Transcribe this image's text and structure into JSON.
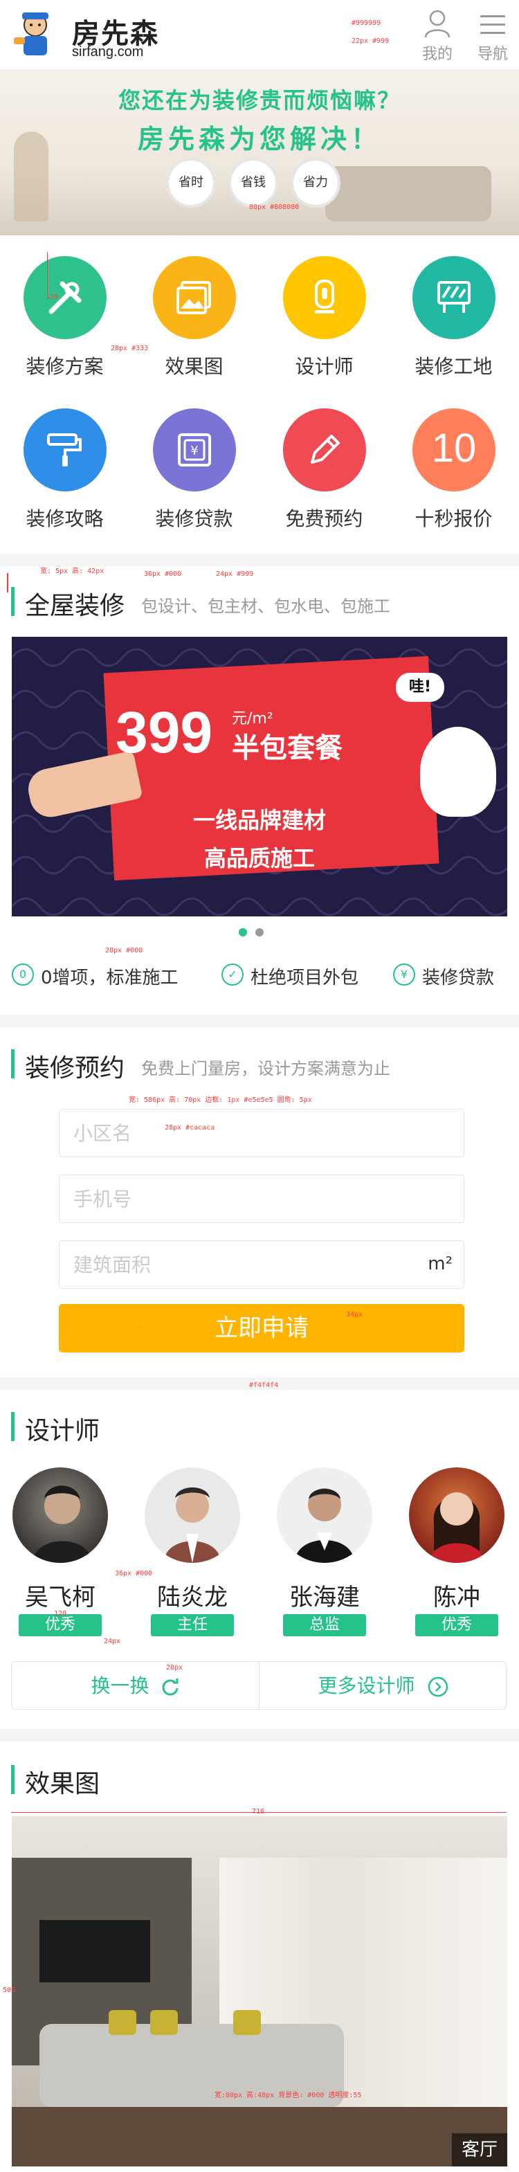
{
  "header": {
    "logo_cn": "房先森",
    "logo_en": "sirfang.com",
    "mine_label": "我的",
    "nav_label": "导航"
  },
  "hero": {
    "line1": "您还在为装修贵而烦恼嘛？",
    "line2": "房先森为您解决！",
    "pills": [
      "省时",
      "省钱",
      "省力"
    ]
  },
  "grid": [
    {
      "label": "装修方案",
      "color": "#2fc28c",
      "icon": "tools-icon"
    },
    {
      "label": "效果图",
      "color": "#fbb415",
      "icon": "gallery-icon"
    },
    {
      "label": "设计师",
      "color": "#ffc600",
      "icon": "pen-nib-icon"
    },
    {
      "label": "装修工地",
      "color": "#21b8a4",
      "icon": "construction-sign-icon"
    },
    {
      "label": "装修攻略",
      "color": "#2f8ee8",
      "icon": "paint-roller-icon"
    },
    {
      "label": "装修贷款",
      "color": "#7a74d6",
      "icon": "loan-document-icon"
    },
    {
      "label": "免费预约",
      "color": "#f04a54",
      "icon": "pencil-icon"
    },
    {
      "label": "十秒报价",
      "color": "#ff7f5a",
      "icon": "ten-seconds-icon",
      "icon_text": "10"
    }
  ],
  "whole_house": {
    "title": "全屋装修",
    "subtitle": "包设计、包主材、包水电、包施工",
    "banner": {
      "price": "399",
      "unit": "元/m²",
      "tag": "半包套餐",
      "line1": "一线品牌建材",
      "line2": "高品质施工",
      "exclaim": "哇!"
    },
    "features": [
      {
        "icon_text": "0",
        "label": "0增项，标准施工"
      },
      {
        "icon_text": "✓",
        "label": "杜绝项目外包"
      },
      {
        "icon_text": "¥",
        "label": "装修贷款"
      }
    ]
  },
  "booking": {
    "title": "装修预约",
    "subtitle": "免费上门量房，设计方案满意为止",
    "community_placeholder": "小区名",
    "phone_placeholder": "手机号",
    "area_placeholder": "建筑面积",
    "area_unit": "m²",
    "submit_label": "立即申请"
  },
  "designers": {
    "title": "设计师",
    "items": [
      {
        "name": "吴飞柯",
        "badge": "优秀"
      },
      {
        "name": "陆炎龙",
        "badge": "主任"
      },
      {
        "name": "张海建",
        "badge": "总监"
      },
      {
        "name": "陈冲",
        "badge": "优秀"
      }
    ],
    "refresh_label": "换一换",
    "more_label": "更多设计师"
  },
  "effects": {
    "title": "效果图",
    "caption": "客厅"
  },
  "annotations": {
    "hdr_color": "#999999",
    "hdr_font": "22px #999",
    "pill_note": "80px #808080",
    "grid_icon": "120",
    "grid_label": "28px #333",
    "sec_bar": "宽: 5px 高: 42px",
    "sec_title": "36px #000",
    "sec_sub": "24px #999",
    "feat_note": "28px #000",
    "field_note": "宽: 586px 高: 70px 边框: 1px #e5e5e5 圆角: 5px",
    "placeholder_note": "28px #cacaca",
    "btn_note": "34px",
    "gap_note": "#f4f4f4",
    "badge_size": "120",
    "badge_font": "24px",
    "name_font": "36px #000",
    "refresh_note": "28px",
    "effect_width": "716",
    "effect_height": "506",
    "caption_note": "宽:80px 高:48px 背景色: #000 透明度:55"
  }
}
